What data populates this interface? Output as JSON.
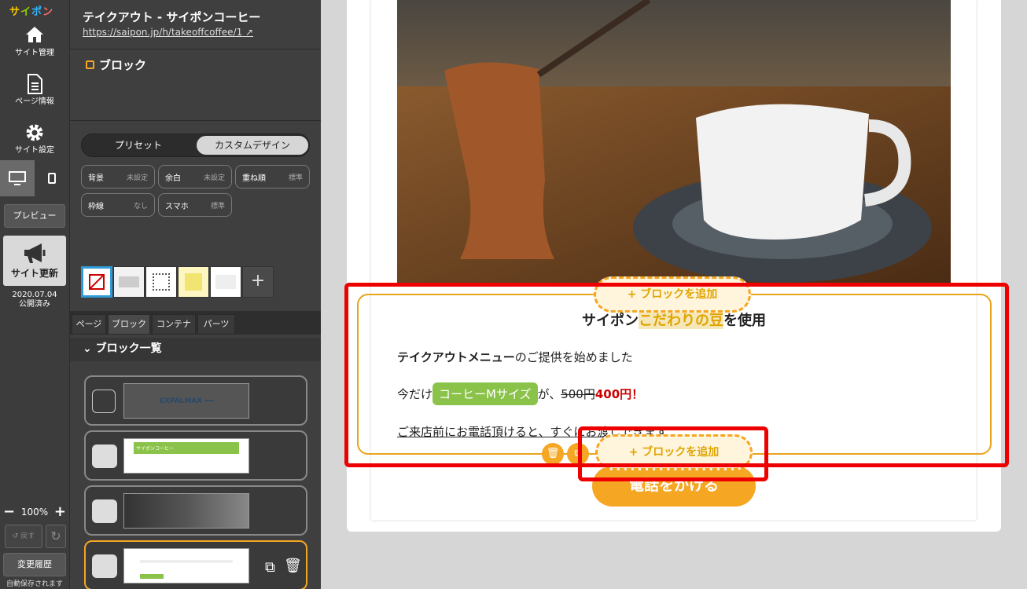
{
  "app": {
    "logo_chars": [
      "サ",
      "イ",
      "ポ",
      "ン"
    ]
  },
  "rail": {
    "site_manage": "サイト管理",
    "page_info": "ページ情報",
    "site_settings": "サイト設定",
    "preview": "プレビュー",
    "update": "サイト更新",
    "update_date": "2020.07.04",
    "update_status": "公開済み",
    "zoom": "100%",
    "undo": "戻す",
    "history": "変更履歴",
    "autosave": "自動保存されます"
  },
  "panel": {
    "site_title": "テイクアウト - サイポンコーヒー",
    "site_url": "https://saipon.jp/h/takeoffcoffee/1",
    "section_title": "ブロック",
    "tabs": [
      "プリセット",
      "カスタムデザイン"
    ],
    "options": [
      {
        "label": "背景",
        "value": "未設定"
      },
      {
        "label": "余白",
        "value": "未設定"
      },
      {
        "label": "重ね順",
        "value": "標準"
      },
      {
        "label": "枠線",
        "value": "なし"
      },
      {
        "label": "スマホ",
        "value": "標準"
      }
    ],
    "swatch_add": "+",
    "bottom_tabs": [
      "ページ",
      "ブロック",
      "コンテナ",
      "パーツ"
    ],
    "block_list_title": "ブロック一覧",
    "thumb_texts": [
      "EXPALMAX ━━",
      "サイポンコーヒー"
    ]
  },
  "canvas": {
    "heading_pre": "サイポン",
    "heading_hl": "こだわりの豆",
    "heading_post": "を使用",
    "line1_bold": "テイクアウトメニュー",
    "line1_rest": "のご提供を始めました",
    "line2_pre": "今だけ",
    "pill": "コーヒーMサイズ",
    "line2_mid": "が、",
    "old_price": "500円",
    "new_price": "400円！",
    "line3": "ご来店前にお電話頂けると、すぐにお渡しできます",
    "add_block": "+ ブロックを追加",
    "call_button": "電話をかける"
  },
  "colors": {
    "accent": "#f5a623",
    "highlight_red": "#e00000",
    "green": "#8bc34a"
  }
}
